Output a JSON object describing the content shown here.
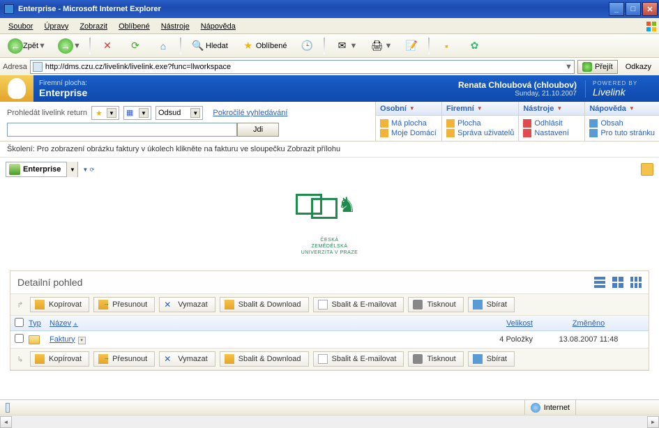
{
  "window": {
    "title": "Enterprise - Microsoft Internet Explorer"
  },
  "menubar": [
    "Soubor",
    "Úpravy",
    "Zobrazit",
    "Oblíbené",
    "Nástroje",
    "Nápověda"
  ],
  "toolbar": {
    "back": "Zpět",
    "search": "Hledat",
    "favorites": "Oblíbené"
  },
  "addressbar": {
    "label": "Adresa",
    "url": "http://dms.czu.cz/livelink/livelink.exe?func=llworkspace",
    "go": "Přejít",
    "links": "Odkazy"
  },
  "livelink_header": {
    "subtitle": "Firemní plocha:",
    "title": "Enterprise",
    "user": "Renata Chloubová (chloubov)",
    "date": "Sunday, 21.10.2007",
    "brand_small": "POWERED BY",
    "brand": "Livelink"
  },
  "searchbox": {
    "label": "Prohledát livelink return",
    "scope": "Odsud",
    "advanced": "Pokročilé vyhledávání",
    "go": "Jdi"
  },
  "nav_tabs": {
    "osobni": {
      "head": "Osobní",
      "links": [
        "Má plocha",
        "Moje Domácí"
      ]
    },
    "firemni": {
      "head": "Firemní",
      "links": [
        "Plocha",
        "Správa uživatelů"
      ]
    },
    "nastroje": {
      "head": "Nástroje",
      "links": [
        "Odhlásit",
        "Nastavení"
      ]
    },
    "napoveda": {
      "head": "Nápověda",
      "links": [
        "Obsah",
        "Pro tuto stránku"
      ]
    }
  },
  "training_msg": "Školení: Pro zobrazení obrázku faktury v úkolech klikněte na fakturu ve sloupečku Zobrazit přílohu",
  "breadcrumb": {
    "name": "Enterprise"
  },
  "logo": {
    "l1": "ČESKÁ",
    "l2": "ZEMĚDĚLSKÁ",
    "l3": "UNIVERZITA V PRAZE"
  },
  "panel": {
    "title": "Detailní pohled",
    "actions": {
      "copy": "Kopírovat",
      "move": "Přesunout",
      "del": "Vymazat",
      "zip": "Sbalit & Download",
      "mail": "Sbalit & E-mailovat",
      "print": "Tisknout",
      "collect": "Sbírat"
    },
    "columns": {
      "typ": "Typ",
      "name": "Název",
      "size": "Velikost",
      "mod": "Změněno"
    },
    "rows": [
      {
        "name": "Faktury",
        "size": "4 Položky",
        "mod": "13.08.2007 11:48"
      }
    ]
  },
  "statusbar": {
    "zone": "Internet"
  }
}
